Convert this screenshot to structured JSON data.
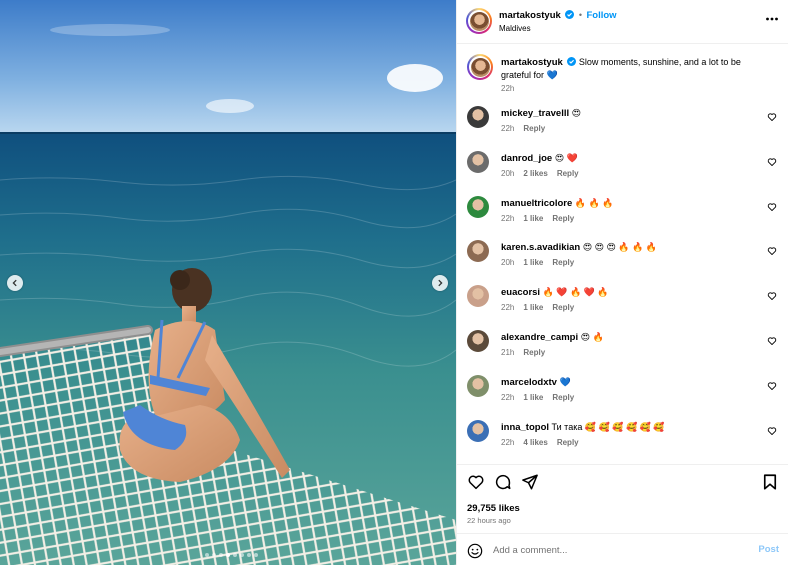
{
  "post": {
    "username": "martakostyuk",
    "follow_label": "Follow",
    "location": "Maldives",
    "caption_text": "Slow moments, sunshine, and a lot to be grateful for 💙",
    "caption_time": "22h",
    "likes": "29,755 likes",
    "posted": "22 hours ago"
  },
  "comments": [
    {
      "username": "mickey_travelll",
      "text": "😍",
      "time": "22h",
      "likes": "",
      "avatar": "#3a3a3a"
    },
    {
      "username": "danrod_joe",
      "text": "😍 ❤️",
      "time": "20h",
      "likes": "2 likes",
      "avatar": "#6b6b6b"
    },
    {
      "username": "manueltricolore",
      "text": "🔥 🔥 🔥",
      "time": "22h",
      "likes": "1 like",
      "avatar": "#2d8a3e"
    },
    {
      "username": "karen.s.avadikian",
      "text": "😍 😍 😍 🔥 🔥 🔥",
      "time": "20h",
      "likes": "1 like",
      "avatar": "#8c6a52"
    },
    {
      "username": "euacorsi",
      "text": "🔥 ❤️ 🔥 ❤️ 🔥",
      "time": "22h",
      "likes": "1 like",
      "avatar": "#c9a08a"
    },
    {
      "username": "alexandre_campi",
      "text": "😍 🔥",
      "time": "21h",
      "likes": "",
      "avatar": "#5b4a3a"
    },
    {
      "username": "marcelodxtv",
      "text": "💙",
      "time": "22h",
      "likes": "1 like",
      "avatar": "#7f8f6a"
    },
    {
      "username": "inna_topol",
      "text": "Ти така 🥰 🥰 🥰 🥰 🥰 🥰",
      "time": "22h",
      "likes": "4 likes",
      "avatar": "#3b6fb5"
    }
  ],
  "labels": {
    "reply": "Reply",
    "add_comment_placeholder": "Add a comment...",
    "post_button": "Post"
  },
  "icons": {
    "verified": "verified-badge-icon",
    "more": "more-options-icon",
    "like": "heart-icon",
    "comment": "comment-icon",
    "share": "paper-plane-icon",
    "save": "bookmark-icon",
    "emoji": "emoji-icon",
    "prev": "chevron-left-icon",
    "next": "chevron-right-icon"
  },
  "carousel": {
    "total": 8,
    "active": 3
  },
  "colors": {
    "accent": "#0095f6",
    "muted": "#737373",
    "post_disabled": "#8ec8f9"
  }
}
